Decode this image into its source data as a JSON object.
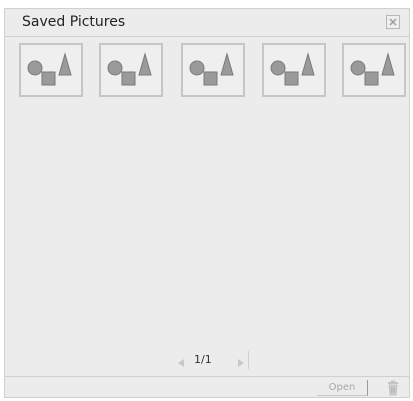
{
  "window": {
    "title": "Saved Pictures"
  },
  "thumbnails": [
    {
      "icon": "shapes-placeholder-icon"
    },
    {
      "icon": "shapes-placeholder-icon"
    },
    {
      "icon": "shapes-placeholder-icon"
    },
    {
      "icon": "shapes-placeholder-icon"
    },
    {
      "icon": "shapes-placeholder-icon"
    }
  ],
  "pager": {
    "text": "1/1"
  },
  "footer": {
    "open_label": "Open"
  },
  "colors": {
    "panel_bg": "#ececec",
    "shape_fill": "#9a9a9a",
    "shape_stroke": "#7a7a7a"
  }
}
